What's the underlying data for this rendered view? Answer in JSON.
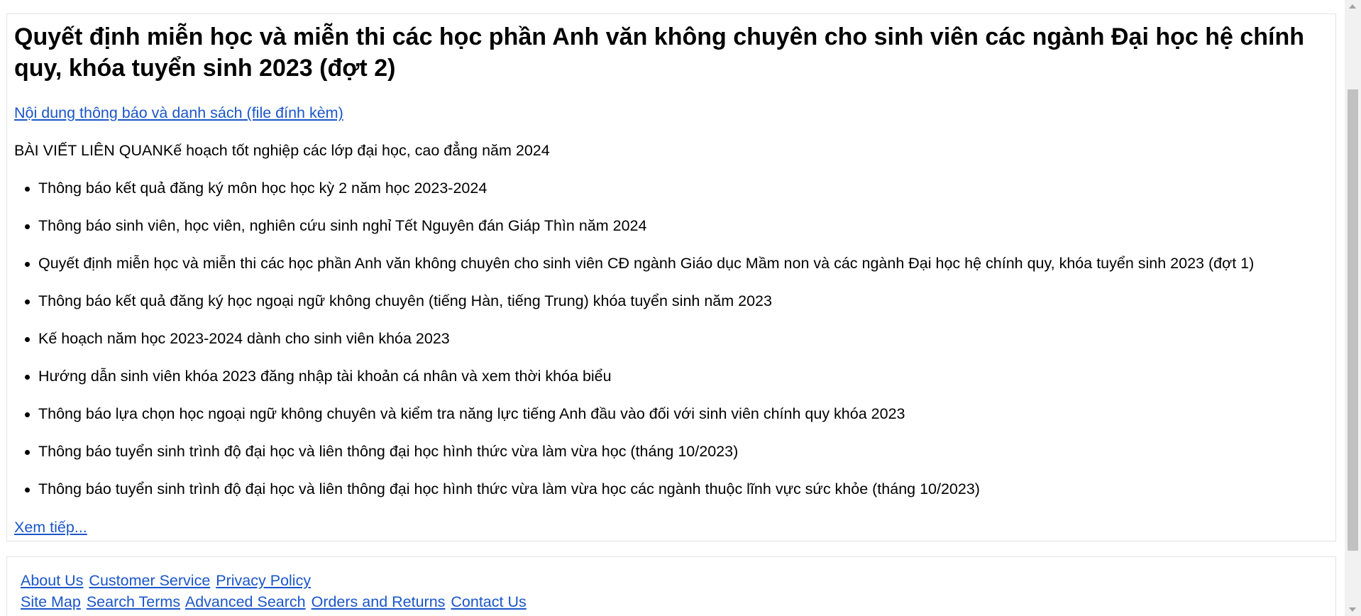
{
  "article": {
    "title": "Quyết định miễn học và miễn thi các học phần Anh văn không chuyên cho sinh viên các ngành Đại học hệ chính quy, khóa tuyển sinh 2023 (đợt 2)",
    "attachment_link": "Nội dung thông báo và danh sách (file đính kèm)"
  },
  "related": {
    "heading": "BÀI VIẾT LIÊN QUAN",
    "first_item": "Kế hoạch tốt nghiệp các lớp đại học, cao đẳng năm 2024",
    "items": [
      "Thông báo kết quả đăng ký môn học học kỳ 2 năm học 2023-2024",
      "Thông báo sinh viên, học viên, nghiên cứu sinh nghỉ Tết Nguyên đán Giáp Thìn năm 2024",
      "Quyết định miễn học và miễn thi các học phần Anh văn không chuyên cho sinh viên CĐ ngành Giáo dục Mầm non và các ngành Đại học hệ chính quy, khóa tuyển sinh 2023 (đợt 1)",
      "Thông báo kết quả đăng ký học ngoại ngữ không chuyên (tiếng Hàn, tiếng Trung) khóa tuyển sinh năm 2023",
      "Kế hoạch năm học 2023-2024 dành cho sinh viên khóa 2023",
      "Hướng dẫn sinh viên khóa 2023 đăng nhập tài khoản cá nhân và xem thời khóa biểu",
      "Thông báo lựa chọn học ngoại ngữ không chuyên và kiểm tra năng lực tiếng Anh đầu vào đối với sinh viên chính quy khóa 2023",
      "Thông báo tuyển sinh trình độ đại học và liên thông đại học hình thức vừa làm vừa học (tháng 10/2023)",
      "Thông báo tuyển sinh trình độ đại học và liên thông đại học hình thức vừa làm vừa học các ngành thuộc lĩnh vực sức khỏe (tháng 10/2023)"
    ],
    "more_link": "Xem tiếp..."
  },
  "footer": {
    "row1": [
      "About Us",
      "Customer Service",
      "Privacy Policy"
    ],
    "row2": [
      "Site Map",
      "Search Terms",
      "Advanced Search",
      "Orders and Returns",
      "Contact Us"
    ]
  },
  "colors": {
    "link": "#1a56c9",
    "border": "#e3e3e3",
    "text": "#000000"
  }
}
